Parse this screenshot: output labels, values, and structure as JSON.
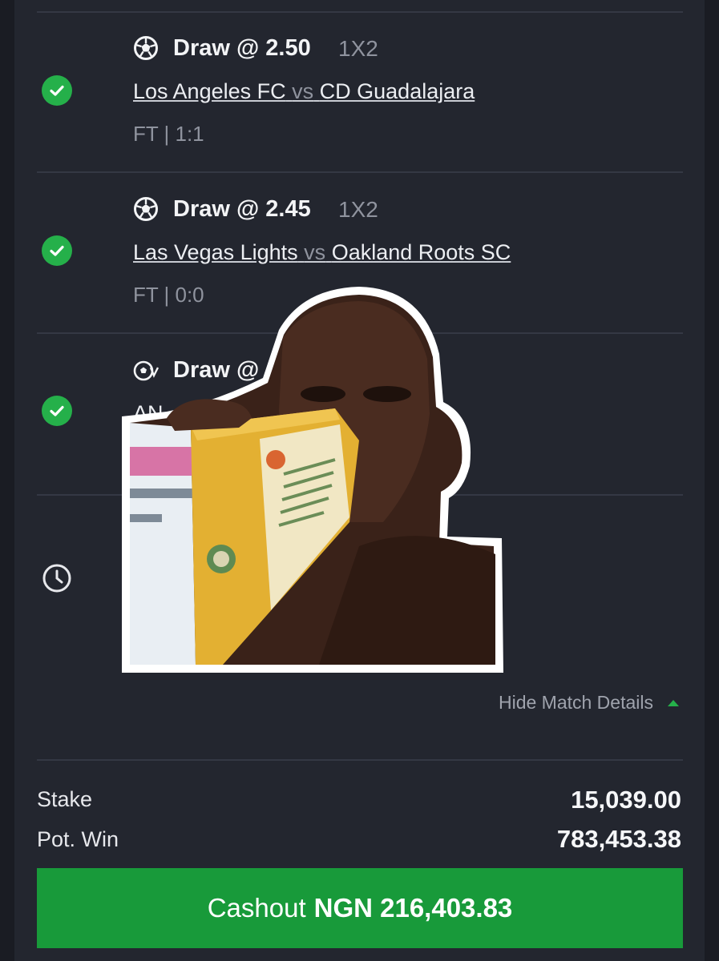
{
  "bets": [
    {
      "market": "Draw @ 2.50",
      "market_type": "1X2",
      "home": "Los Angeles FC",
      "vs": "vs",
      "away": "CD Guadalajara",
      "result": "FT | 1:1",
      "status_icon": "check-circle-icon"
    },
    {
      "market": "Draw @ 2.45",
      "market_type": "1X2",
      "home": "Las Vegas Lights",
      "vs": "vs",
      "away": "Oakland Roots SC",
      "result": "FT | 0:0",
      "status_icon": "check-circle-icon"
    },
    {
      "market": "Draw @",
      "match_partial": "AN",
      "status_icon": "check-circle-icon"
    },
    {
      "status_icon": "clock-icon"
    }
  ],
  "hide_details_label": "Hide Match Details",
  "summary": {
    "stake_label": "Stake",
    "stake_value": "15,039.00",
    "potwin_label": "Pot. Win",
    "potwin_value": "783,453.38"
  },
  "cashout": {
    "label": "Cashout",
    "amount": "NGN 216,403.83"
  },
  "colors": {
    "background": "#23262f",
    "accent_green": "#189a3a",
    "check_green": "#25b04a",
    "muted_text": "#8f939e"
  }
}
